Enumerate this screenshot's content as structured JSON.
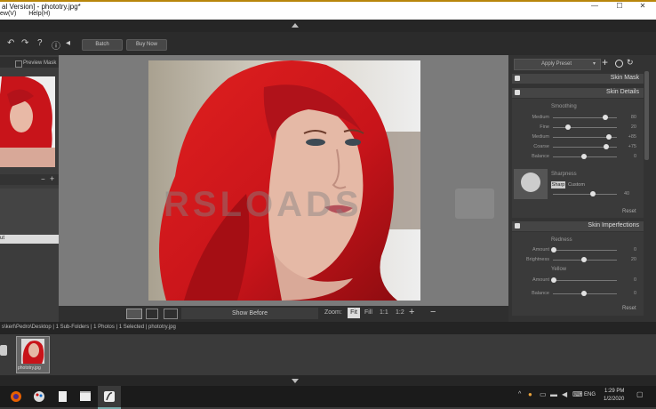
{
  "window": {
    "title": "al Version] - phototry.jpg*",
    "menu": [
      "ew(V)",
      "Help(H)"
    ],
    "controls": {
      "minimize": "—",
      "maximize": "☐",
      "close": "✕"
    }
  },
  "toolbar": {
    "batch_label": "Batch",
    "buy_label": "Buy Now"
  },
  "left_panel": {
    "preview_mask_label": "Preview Mask",
    "item_label": "ut"
  },
  "view_bar": {
    "show_before_label": "Show Before",
    "zoom_label": "Zoom:",
    "fit_label": "Fit",
    "fill_label": "Fill",
    "one_to_one": "1:1",
    "one_to_two": "1:2"
  },
  "right_panel": {
    "preset_label": "Apply Preset",
    "skin_mask": "Skin Mask",
    "skin_details": "Skin Details",
    "smoothing_label": "Smoothing",
    "smoothing_sliders": [
      {
        "name": "Medium",
        "value": "80"
      },
      {
        "name": "Fine",
        "value": "20"
      },
      {
        "name": "Medium",
        "value": "+85"
      },
      {
        "name": "Coarse",
        "value": "+75"
      },
      {
        "name": "Balance",
        "value": "0"
      }
    ],
    "sharpness_label": "Sharpness",
    "opacity_choices": [
      "Sharp",
      "Custom"
    ],
    "opacity_value": "40",
    "reset_label": "Reset",
    "skin_imperfections": "Skin Imperfections",
    "redness_label": "Redness",
    "redness_sliders": [
      {
        "name": "Amount",
        "value": "0"
      },
      {
        "name": "Brightness",
        "value": "20"
      }
    ],
    "yellow_label": "Yellow",
    "yellow_sliders": [
      {
        "name": "Amount",
        "value": "0"
      },
      {
        "name": "Balance",
        "value": "0"
      }
    ],
    "reset_label_2": "Reset"
  },
  "watermark": "RSLOADS",
  "status_bar": {
    "path": "s\\kerl\\Pedro\\Desktop | 1 Sub-Folders | 1 Photos | 1 Selected | phototry.jpg"
  },
  "filmstrip": {
    "thumb_label": "phototry.jpg"
  },
  "taskbar": {
    "lang": "ENG",
    "time": "1:29 PM",
    "date": "1/2/2020"
  },
  "colors": {
    "hair": "#c8141a",
    "panel_bg": "#333333",
    "canvas_bg": "#7b7b7b",
    "accent_gold": "#b8860b"
  }
}
